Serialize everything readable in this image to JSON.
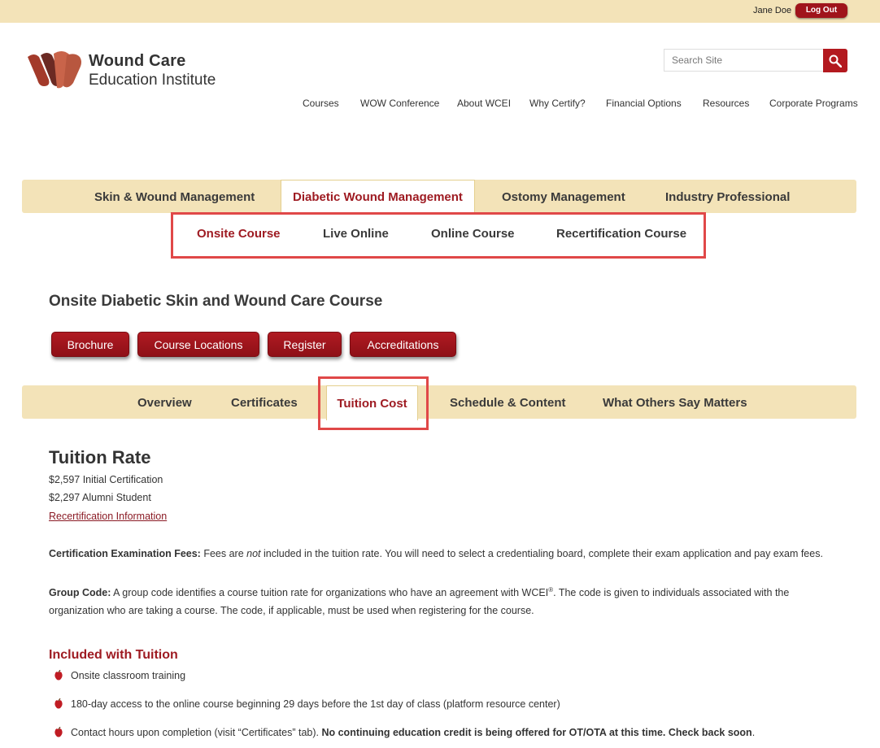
{
  "topbar": {
    "user_name": "Jane Doe",
    "logout_label": "Log Out"
  },
  "logo": {
    "line1": "Wound Care",
    "line2": "Education Institute"
  },
  "search": {
    "placeholder": "Search Site"
  },
  "main_nav": [
    "Courses",
    "WOW Conference",
    "About WCEI",
    "Why Certify?",
    "Financial Options",
    "Resources",
    "Corporate Programs"
  ],
  "course_tabs": [
    "Skin & Wound Management",
    "Diabetic Wound Management",
    "Ostomy Management",
    "Industry Professional"
  ],
  "course_tabs_active": "Diabetic Wound Management",
  "sub_nav": [
    "Onsite Course",
    "Live Online",
    "Online Course",
    "Recertification Course"
  ],
  "sub_nav_active": "Onsite Course",
  "course_title": "Onsite Diabetic Skin and Wound Care Course",
  "action_buttons": [
    "Brochure",
    "Course Locations",
    "Register",
    "Accreditations"
  ],
  "detail_tabs": [
    "Overview",
    "Certificates",
    "Tuition Cost",
    "Schedule & Content",
    "What Others Say Matters"
  ],
  "detail_tabs_active": "Tuition Cost",
  "tuition": {
    "heading": "Tuition Rate",
    "rates": [
      "$2,597 Initial Certification",
      "$2,297 Alumni Student"
    ],
    "recert_link": "Recertification Information"
  },
  "exam_fees": {
    "label": "Certification Examination Fees:",
    "text_before": " Fees are ",
    "emphasis": "not",
    "text_after": " included in the tuition rate.  You will need to select a credentialing board, complete their exam application and pay exam fees."
  },
  "group_code": {
    "label": "Group Code:",
    "text_before": " A group code identifies a course tuition rate for organizations who have an agreement with WCEI",
    "superscript": "®",
    "text_after": ". The code is given to individuals associated with the organization who are taking a course. The code, if applicable, must be used when registering for the course."
  },
  "included": {
    "heading": "Included with Tuition",
    "items": [
      "Onsite classroom training",
      "180-day access to the online course beginning 29 days before the 1st day of class (platform resource center)"
    ],
    "item3_text": "Contact hours upon completion (visit “Certificates” tab). ",
    "item3_bold": "No continuing education credit is being offered for OT/OTA at this time. Check back soon",
    "item3_end": "."
  },
  "colors": {
    "accent": "#9e1b22",
    "tab_bar": "#f3e3b8",
    "highlight_box": "#e04848"
  }
}
